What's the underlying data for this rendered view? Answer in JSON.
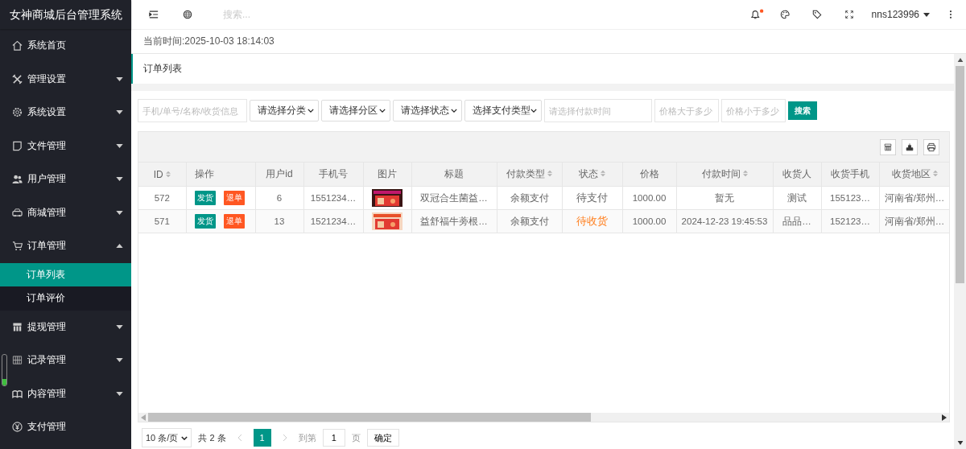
{
  "brand": "女神商城后台管理系统",
  "sidebar": {
    "items": [
      {
        "kind": "link",
        "label": "系统首页"
      },
      {
        "kind": "group",
        "label": "管理设置",
        "expanded": false
      },
      {
        "kind": "group",
        "label": "系统设置",
        "expanded": false
      },
      {
        "kind": "group",
        "label": "文件管理",
        "expanded": false
      },
      {
        "kind": "group",
        "label": "用户管理",
        "expanded": false
      },
      {
        "kind": "group",
        "label": "商城管理",
        "expanded": false
      },
      {
        "kind": "group",
        "label": "订单管理",
        "expanded": true,
        "children": [
          {
            "label": "订单列表",
            "selected": true
          },
          {
            "label": "订单评价",
            "selected": false
          }
        ]
      },
      {
        "kind": "group",
        "label": "提现管理",
        "expanded": false
      },
      {
        "kind": "group",
        "label": "记录管理",
        "expanded": false
      },
      {
        "kind": "group",
        "label": "内容管理",
        "expanded": false
      },
      {
        "kind": "link",
        "label": "支付管理"
      }
    ]
  },
  "header": {
    "search_placeholder": "搜索...",
    "notification": true,
    "user": "nns123996"
  },
  "current_time": "当前时间:2025-10-03 18:14:03",
  "tab": "订单列表",
  "filters": [
    {
      "kind": "input",
      "placeholder": "手机/单号/名称/收货信息"
    },
    {
      "kind": "select",
      "value": "请选择分类"
    },
    {
      "kind": "select",
      "value": "请选择分区"
    },
    {
      "kind": "select",
      "value": "请选择状态"
    },
    {
      "kind": "select",
      "value": "选择支付类型"
    },
    {
      "kind": "input",
      "placeholder": "请选择付款时间"
    },
    {
      "kind": "input",
      "placeholder": "价格大于多少"
    },
    {
      "kind": "input",
      "placeholder": "价格小于多少"
    }
  ],
  "search_button": "搜索",
  "table": {
    "columns": [
      {
        "label": "ID",
        "sortable": true
      },
      {
        "label": "操作",
        "sortable": false
      },
      {
        "label": "用户id",
        "sortable": false
      },
      {
        "label": "手机号",
        "sortable": false
      },
      {
        "label": "图片",
        "sortable": false
      },
      {
        "label": "标题",
        "sortable": false
      },
      {
        "label": "付款类型",
        "sortable": true
      },
      {
        "label": "状态",
        "sortable": true
      },
      {
        "label": "价格",
        "sortable": false
      },
      {
        "label": "付款时间",
        "sortable": true
      },
      {
        "label": "收货人",
        "sortable": false
      },
      {
        "label": "收货手机",
        "sortable": false
      },
      {
        "label": "收货地区",
        "sortable": true
      }
    ],
    "rows": [
      {
        "id": "572",
        "actions": [
          "发货",
          "退单"
        ],
        "user_id": "6",
        "phone": "1551234…",
        "title": "双冠合生菌益…",
        "pay_type": "余额支付",
        "status": {
          "text": "待支付",
          "color": "#666666"
        },
        "price": "1000.00",
        "pay_time": "暂无",
        "receiver": "测试",
        "receiver_phone": "155123…",
        "region": "河南省/郑州…"
      },
      {
        "id": "571",
        "actions": [
          "发货",
          "退单"
        ],
        "user_id": "13",
        "phone": "1521234…",
        "title": "益舒福牛蒡根…",
        "pay_type": "余额支付",
        "status": {
          "text": "待收货",
          "color": "#ff7f1e"
        },
        "price": "1000.00",
        "pay_time": "2024-12-23 19:45:53",
        "receiver": "品品…",
        "receiver_phone": "152123…",
        "region": "河南省/郑州…"
      }
    ]
  },
  "pagination": {
    "page_size": "10 条/页",
    "total": "共 2 条",
    "pages": [
      {
        "label": "1",
        "selected": true
      }
    ],
    "goto_label": "到第",
    "goto_value": "1",
    "page_unit": "页",
    "confirm": "确定"
  }
}
